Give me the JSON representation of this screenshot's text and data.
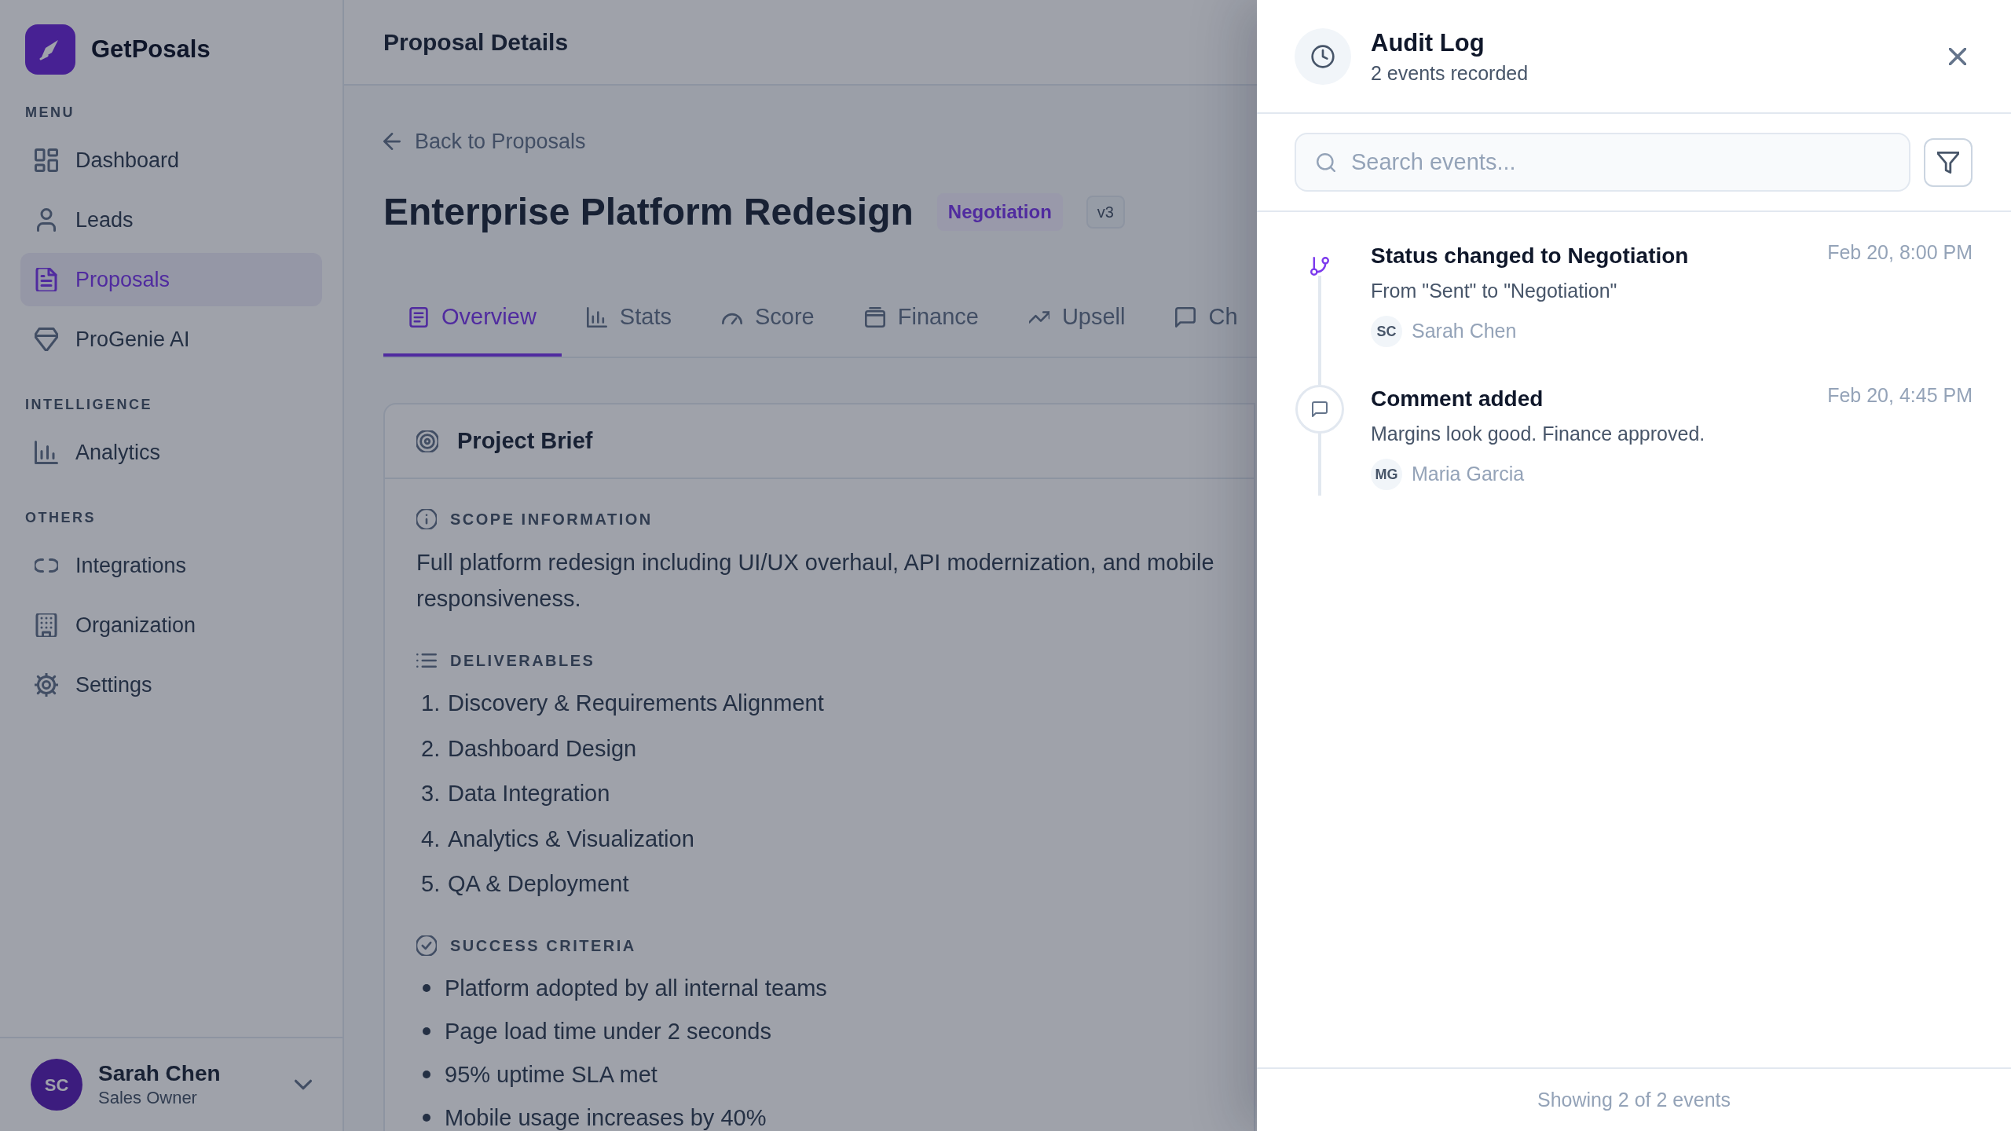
{
  "sidebar": {
    "brand": "GetPosals",
    "sections": [
      {
        "heading": "MENU",
        "items": [
          {
            "label": "Dashboard",
            "selected": false
          },
          {
            "label": "Leads",
            "selected": false
          },
          {
            "label": "Proposals",
            "selected": true
          },
          {
            "label": "ProGenie AI",
            "selected": false
          }
        ]
      },
      {
        "heading": "INTELLIGENCE",
        "items": [
          {
            "label": "Analytics",
            "selected": false
          }
        ]
      },
      {
        "heading": "OTHERS",
        "items": [
          {
            "label": "Integrations",
            "selected": false
          },
          {
            "label": "Organization",
            "selected": false
          },
          {
            "label": "Settings",
            "selected": false
          }
        ]
      }
    ],
    "user": {
      "initials": "SC",
      "name": "Sarah Chen",
      "role": "Sales Owner"
    }
  },
  "header": {
    "title": "Proposal Details"
  },
  "proposal": {
    "back_link": "Back to Proposals",
    "title": "Enterprise Platform Redesign",
    "status": "Negotiation",
    "version": "v3"
  },
  "tabs": [
    {
      "label": "Overview",
      "selected": true
    },
    {
      "label": "Stats",
      "selected": false
    },
    {
      "label": "Score",
      "selected": false
    },
    {
      "label": "Finance",
      "selected": false
    },
    {
      "label": "Upsell",
      "selected": false
    },
    {
      "label": "Ch",
      "selected": false
    }
  ],
  "project_brief": {
    "title": "Project Brief",
    "sections": [
      {
        "kind": "text",
        "heading": "SCOPE INFORMATION",
        "text": "Full platform redesign including UI/UX overhaul, API modernization, and mobile responsiveness."
      },
      {
        "kind": "numbered",
        "heading": "DELIVERABLES",
        "items": [
          {
            "number": "1.",
            "text": "Discovery & Requirements Alignment"
          },
          {
            "number": "2.",
            "text": "Dashboard Design"
          },
          {
            "number": "3.",
            "text": "Data Integration"
          },
          {
            "number": "4.",
            "text": "Analytics & Visualization"
          },
          {
            "number": "5.",
            "text": "QA & Deployment"
          }
        ]
      },
      {
        "kind": "bulleted",
        "heading": "SUCCESS CRITERIA",
        "items": [
          {
            "text": "Platform adopted by all internal teams"
          },
          {
            "text": "Page load time under 2 seconds"
          },
          {
            "text": "95% uptime SLA met"
          },
          {
            "text": "Mobile usage increases by 40%"
          }
        ]
      }
    ]
  },
  "audit_log": {
    "title": "Audit Log",
    "subtitle": "2 events recorded",
    "search": {
      "placeholder": "Search events..."
    },
    "events": [
      {
        "kind": "status_change",
        "title": "Status changed to Negotiation",
        "time": "Feb 20, 8:00 PM",
        "description": "From \"Sent\" to \"Negotiation\"",
        "actor": {
          "initials": "SC",
          "name": "Sarah Chen"
        }
      },
      {
        "kind": "comment",
        "title": "Comment added",
        "time": "Feb 20, 4:45 PM",
        "description": "Margins look good. Finance approved.",
        "actor": {
          "initials": "MG",
          "name": "Maria Garcia"
        }
      }
    ],
    "footer": "Showing 2 of 2 events"
  }
}
